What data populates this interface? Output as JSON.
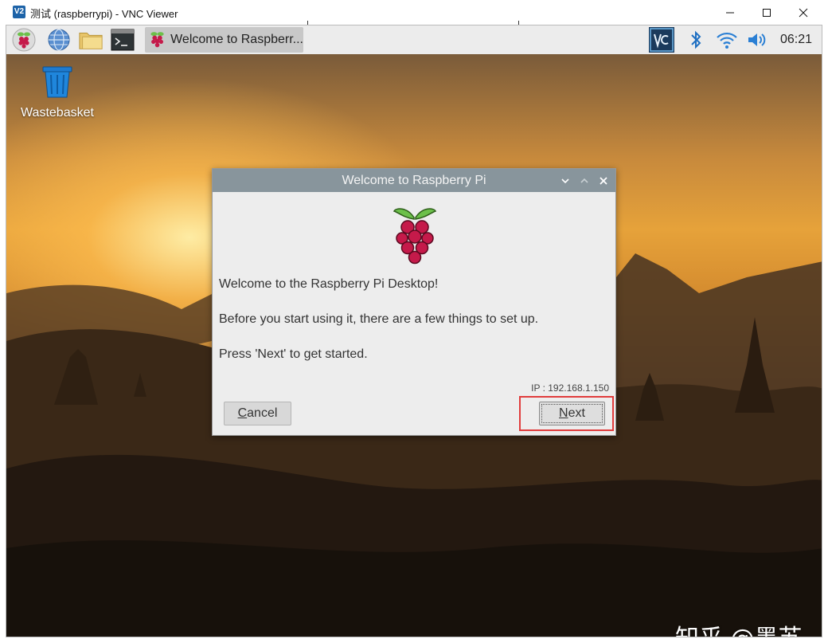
{
  "host_window": {
    "logo_text": "V2",
    "title": "测试 (raspberrypi) - VNC Viewer"
  },
  "panel": {
    "launchers": [
      "raspberry-menu-icon",
      "web-browser-icon",
      "file-manager-icon",
      "terminal-icon"
    ],
    "task_button_label": "Welcome to Raspberr...",
    "tray": [
      "vnc-server-icon",
      "bluetooth-icon",
      "wifi-icon",
      "volume-icon"
    ],
    "clock": "06:21"
  },
  "desktop": {
    "icons": [
      {
        "label": "Wastebasket",
        "icon": "wastebasket-icon"
      }
    ],
    "watermark": "知乎 @墨苏"
  },
  "dialog": {
    "title": "Welcome to Raspberry Pi",
    "line1": "Welcome to the Raspberry Pi Desktop!",
    "line2": "Before you start using it, there are a few things to set up.",
    "line3": "Press 'Next' to get started.",
    "ip": "IP : 192.168.1.150",
    "cancel_first": "C",
    "cancel_rest": "ancel",
    "next_first": "N",
    "next_rest": "ext"
  },
  "colors": {
    "titlebar": "#88959c",
    "highlight": "#e03c3c",
    "raspberry": "#c51a4a",
    "leaf": "#6cc04a"
  }
}
